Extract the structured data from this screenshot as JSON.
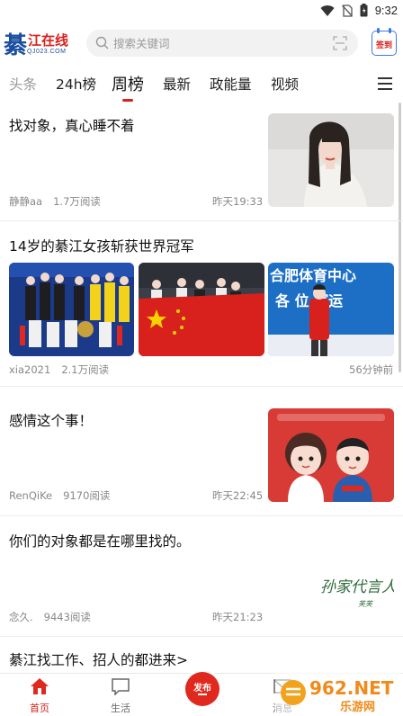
{
  "status_bar": {
    "time": "9:32",
    "icons": [
      "wifi-icon",
      "no-sim-icon",
      "battery-icon"
    ]
  },
  "header": {
    "logo_char": "綦",
    "logo_text": "江在线",
    "logo_url": "QJ023.COM",
    "search_placeholder": "搜索关键词",
    "signin_label": "签到"
  },
  "tabs": [
    {
      "label": "头条",
      "state": "muted"
    },
    {
      "label": "24h榜",
      "state": "normal"
    },
    {
      "label": "周榜",
      "state": "active"
    },
    {
      "label": "最新",
      "state": "normal"
    },
    {
      "label": "政能量",
      "state": "normal"
    },
    {
      "label": "视频",
      "state": "normal"
    }
  ],
  "articles": [
    {
      "title": "找对象，真心睡不着",
      "author": "静静aa",
      "reads": "1.7万阅读",
      "time": "昨天19:33"
    },
    {
      "title": "14岁的綦江女孩斩获世界冠军",
      "author": "xia2021",
      "reads": "2.1万阅读",
      "time": "56分钟前",
      "thumb_banner": "合肥体育中心 各位 赛运"
    },
    {
      "title": "感情这个事！",
      "author": "RenQiKe",
      "reads": "9170阅读",
      "time": "昨天22:45"
    },
    {
      "title": "你们的对象都是在哪里找的。",
      "author": "念久.",
      "reads": "9443阅读",
      "time": "昨天21:23",
      "signature": "孙家代言人",
      "signature_sub": "芙芙"
    },
    {
      "title": "綦江找工作、招人的都进来>"
    }
  ],
  "bottom_nav": {
    "home": "首页",
    "life": "生活",
    "publish": "发布",
    "other": "消息"
  },
  "watermark": {
    "brand": "962.NET",
    "sub": "乐游网"
  },
  "colors": {
    "accent": "#d8201c",
    "brand_blue": "#1a4ea0"
  }
}
